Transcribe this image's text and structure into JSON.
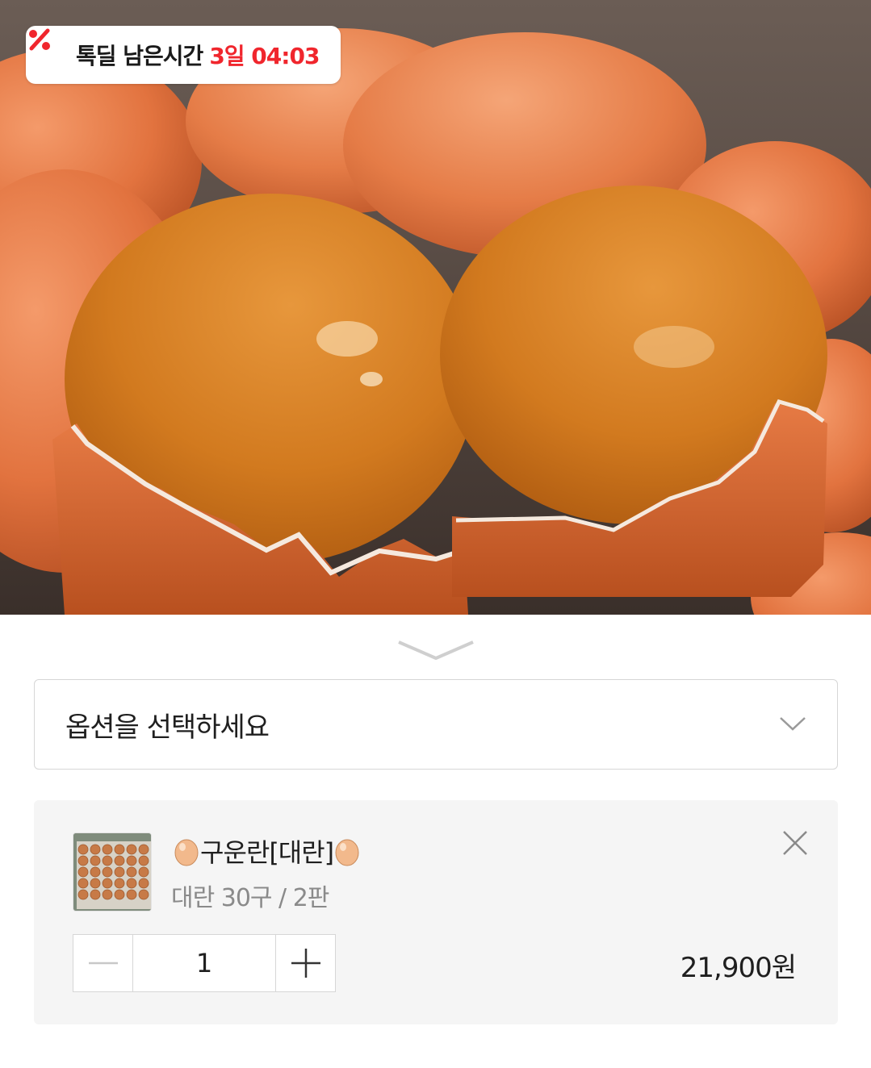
{
  "deal_badge": {
    "label": "톡딜 남은시간",
    "remaining": "3일 04:03",
    "icon": "percent-icon",
    "accent_color": "#f0262d"
  },
  "hero_image": {
    "icon": "peeled-roasted-eggs-photo"
  },
  "option_select": {
    "placeholder": "옵션을 선택하세요",
    "icon": "chevron-down-icon"
  },
  "selected_option": {
    "name": "구운란[대란]",
    "name_icons": [
      "egg-icon",
      "egg-icon"
    ],
    "detail": "대란 30구 / 2판",
    "thumbnail_icon": "egg-tray-photo",
    "quantity": "1",
    "price": "21,900원",
    "remove_icon": "close-icon",
    "minus_icon": "minus-icon",
    "plus_icon": "plus-icon"
  }
}
